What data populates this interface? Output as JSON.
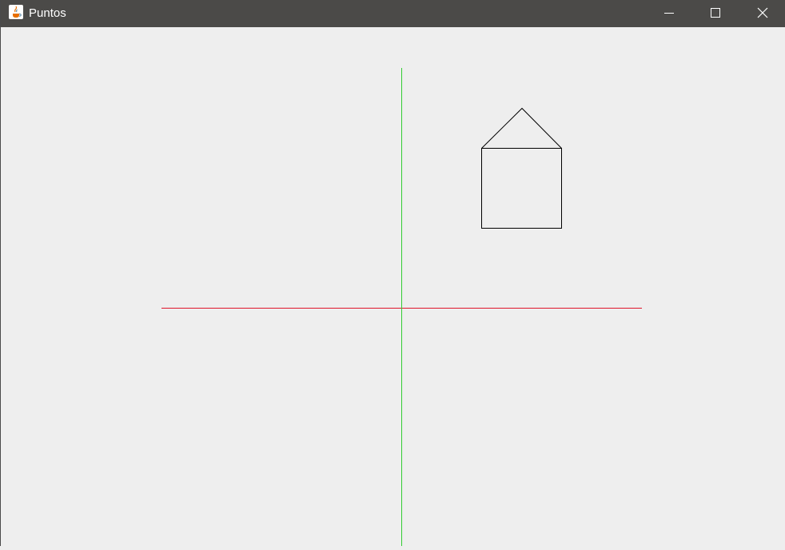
{
  "window": {
    "title": "Puntos",
    "icon": "java-cup-icon",
    "controls": [
      "minimize-icon",
      "maximize-icon",
      "close-icon"
    ]
  },
  "colors": {
    "titlebar": "#4b4a48",
    "background": "#eeeeee",
    "x_axis": "#e0142a",
    "y_axis": "#33cc33",
    "shape": "#000000"
  }
}
